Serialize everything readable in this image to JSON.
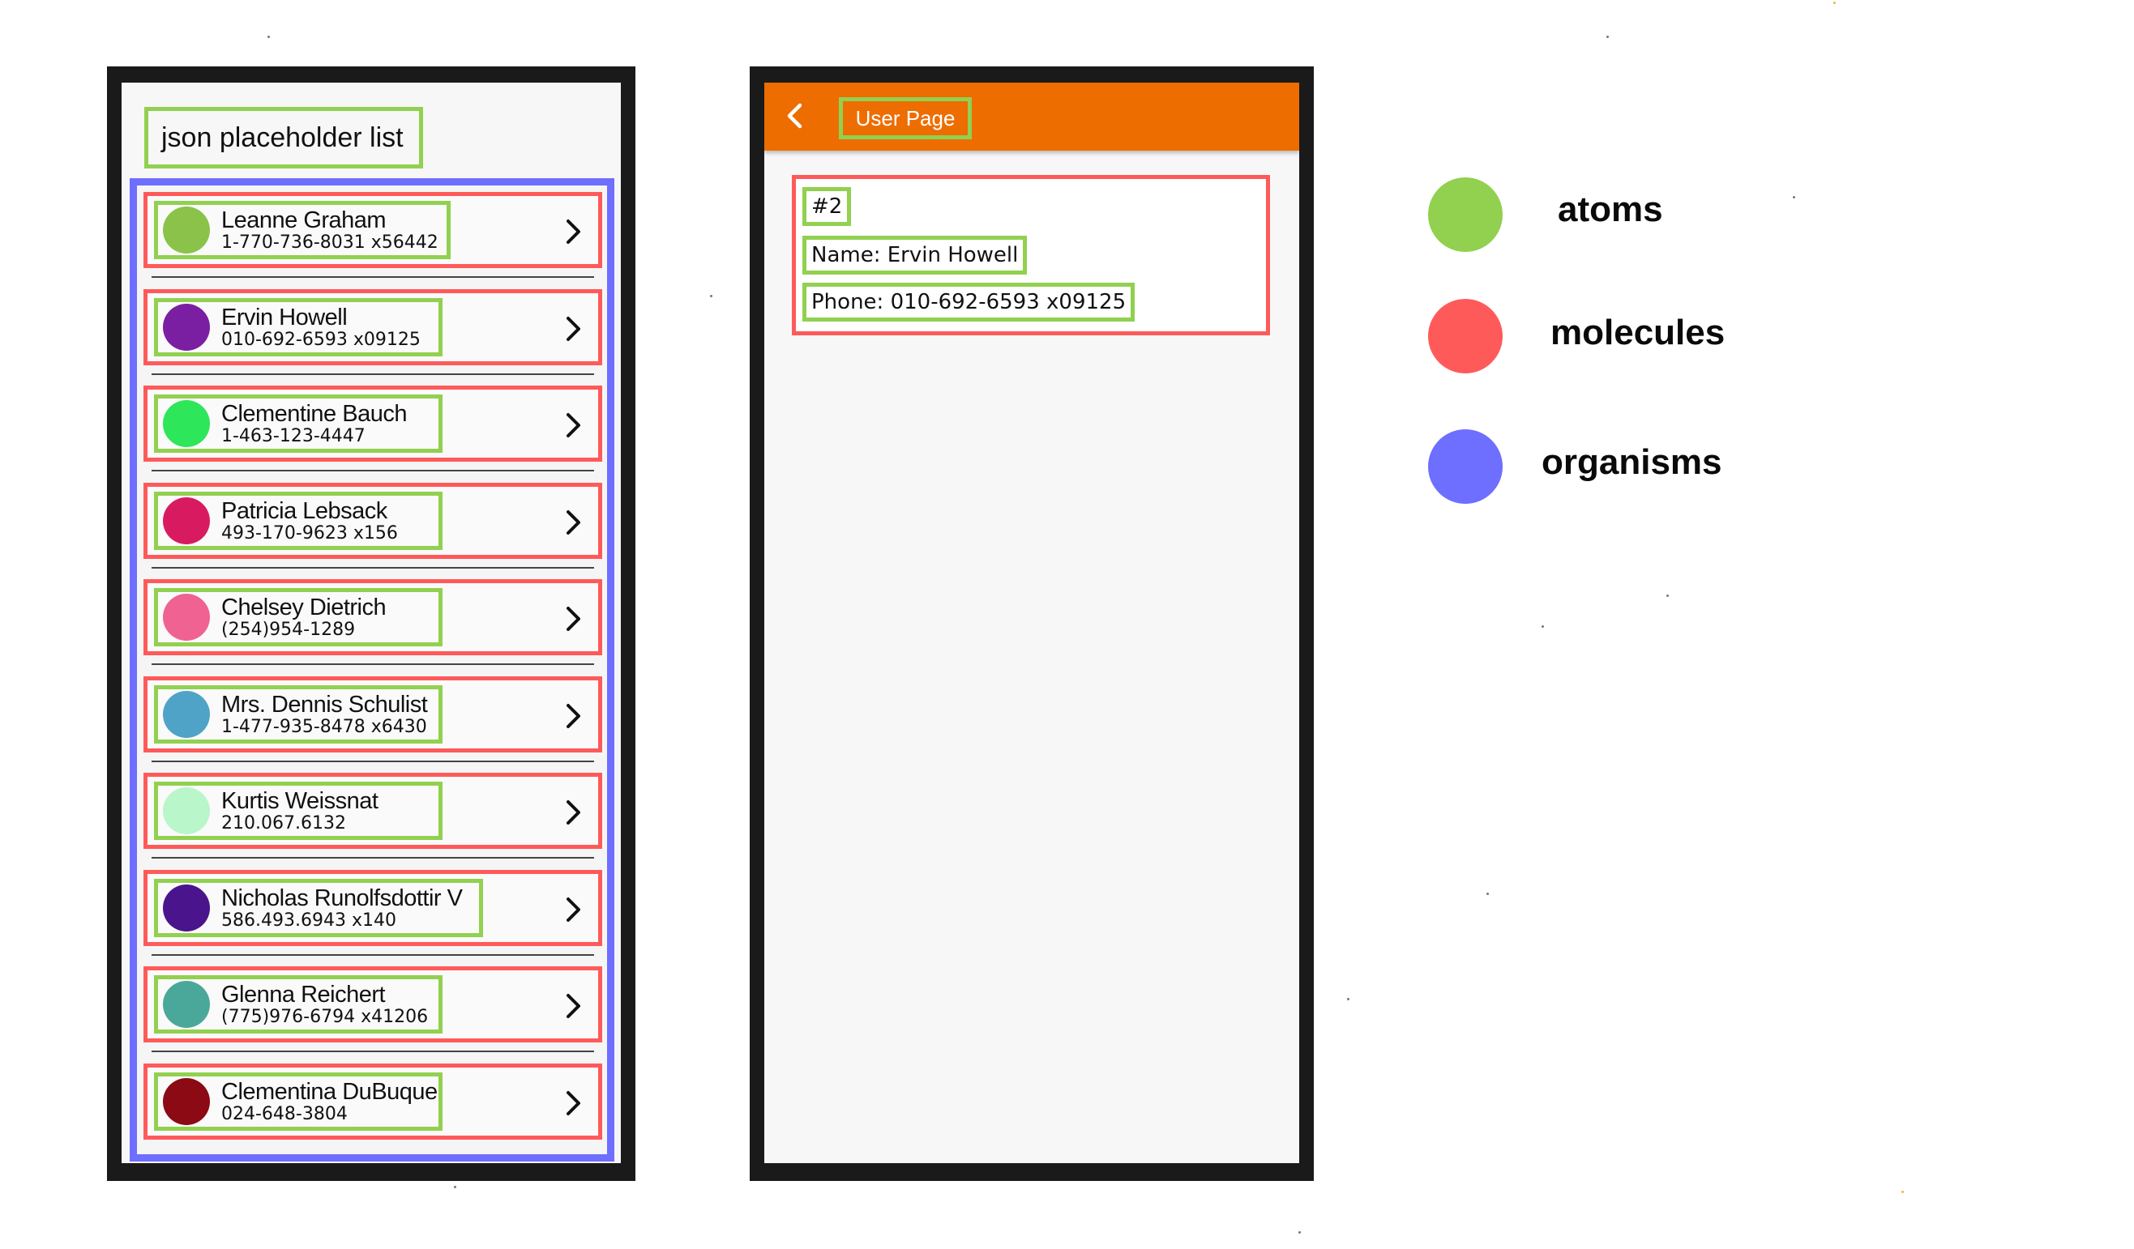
{
  "list_screen": {
    "title": "json placeholder list",
    "users": [
      {
        "name": "Leanne Graham",
        "phone": "1-770-736-8031 x56442",
        "avatar_color": "#8bc34a"
      },
      {
        "name": "Ervin Howell",
        "phone": "010-692-6593 x09125",
        "avatar_color": "#7b1fa2"
      },
      {
        "name": "Clementine Bauch",
        "phone": "1-463-123-4447",
        "avatar_color": "#2ee65a"
      },
      {
        "name": "Patricia Lebsack",
        "phone": "493-170-9623 x156",
        "avatar_color": "#d81b60"
      },
      {
        "name": "Chelsey Dietrich",
        "phone": "(254)954-1289",
        "avatar_color": "#f06292"
      },
      {
        "name": "Mrs. Dennis Schulist",
        "phone": "1-477-935-8478 x6430",
        "avatar_color": "#4fa3c7"
      },
      {
        "name": "Kurtis Weissnat",
        "phone": "210.067.6132",
        "avatar_color": "#b9f6ca"
      },
      {
        "name": "Nicholas Runolfsdottir V",
        "phone": "586.493.6943 x140",
        "avatar_color": "#4a148c"
      },
      {
        "name": "Glenna Reichert",
        "phone": "(775)976-6794 x41206",
        "avatar_color": "#4aa89a"
      },
      {
        "name": "Clementina DuBuque",
        "phone": "024-648-3804",
        "avatar_color": "#8b0a14"
      }
    ]
  },
  "user_screen": {
    "appbar_title": "User Page",
    "appbar_color": "#ed6d00",
    "id_text": "#2",
    "name_text": "Name: Ervin Howell",
    "phone_text": "Phone: 010-692-6593 x09125"
  },
  "legend": [
    {
      "label": "atoms",
      "color": "#92d050"
    },
    {
      "label": "molecules",
      "color": "#ff5a5a"
    },
    {
      "label": "organisms",
      "color": "#6e6eff"
    }
  ],
  "icons": {
    "row_action": "chevron-right-icon",
    "back": "chevron-left-icon"
  }
}
